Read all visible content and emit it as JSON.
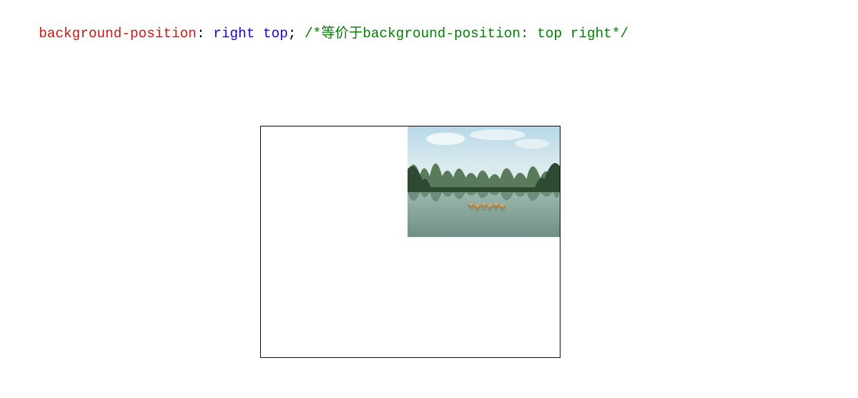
{
  "code": {
    "property": "background-position",
    "colon": ": ",
    "value1": "right",
    "space": " ",
    "value2": "top",
    "semicolon": "; ",
    "comment": "/*等价于background-position: top right*/"
  },
  "demo": {
    "alt": "landscape-photo"
  }
}
